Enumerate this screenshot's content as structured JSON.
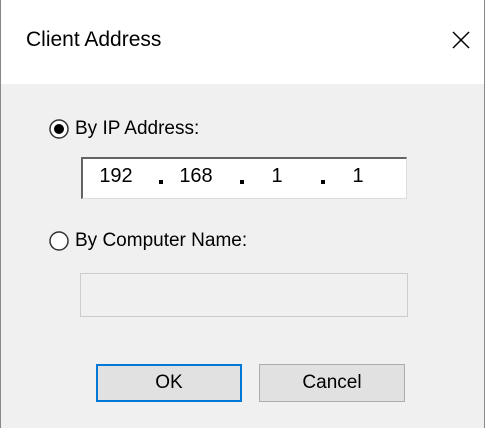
{
  "window": {
    "title": "Client Address",
    "close_glyph": "close-icon"
  },
  "options": {
    "ip": {
      "label": "By IP Address:",
      "selected": true
    },
    "name": {
      "label": "By Computer Name:",
      "selected": false
    }
  },
  "ip_address": {
    "octets": [
      "192",
      "168",
      "1",
      "1"
    ]
  },
  "computer_name": {
    "value": ""
  },
  "buttons": {
    "ok_label": "OK",
    "cancel_label": "Cancel"
  },
  "colors": {
    "dialog_background": "#f0f0f0",
    "default_button_border": "#0078d7"
  }
}
